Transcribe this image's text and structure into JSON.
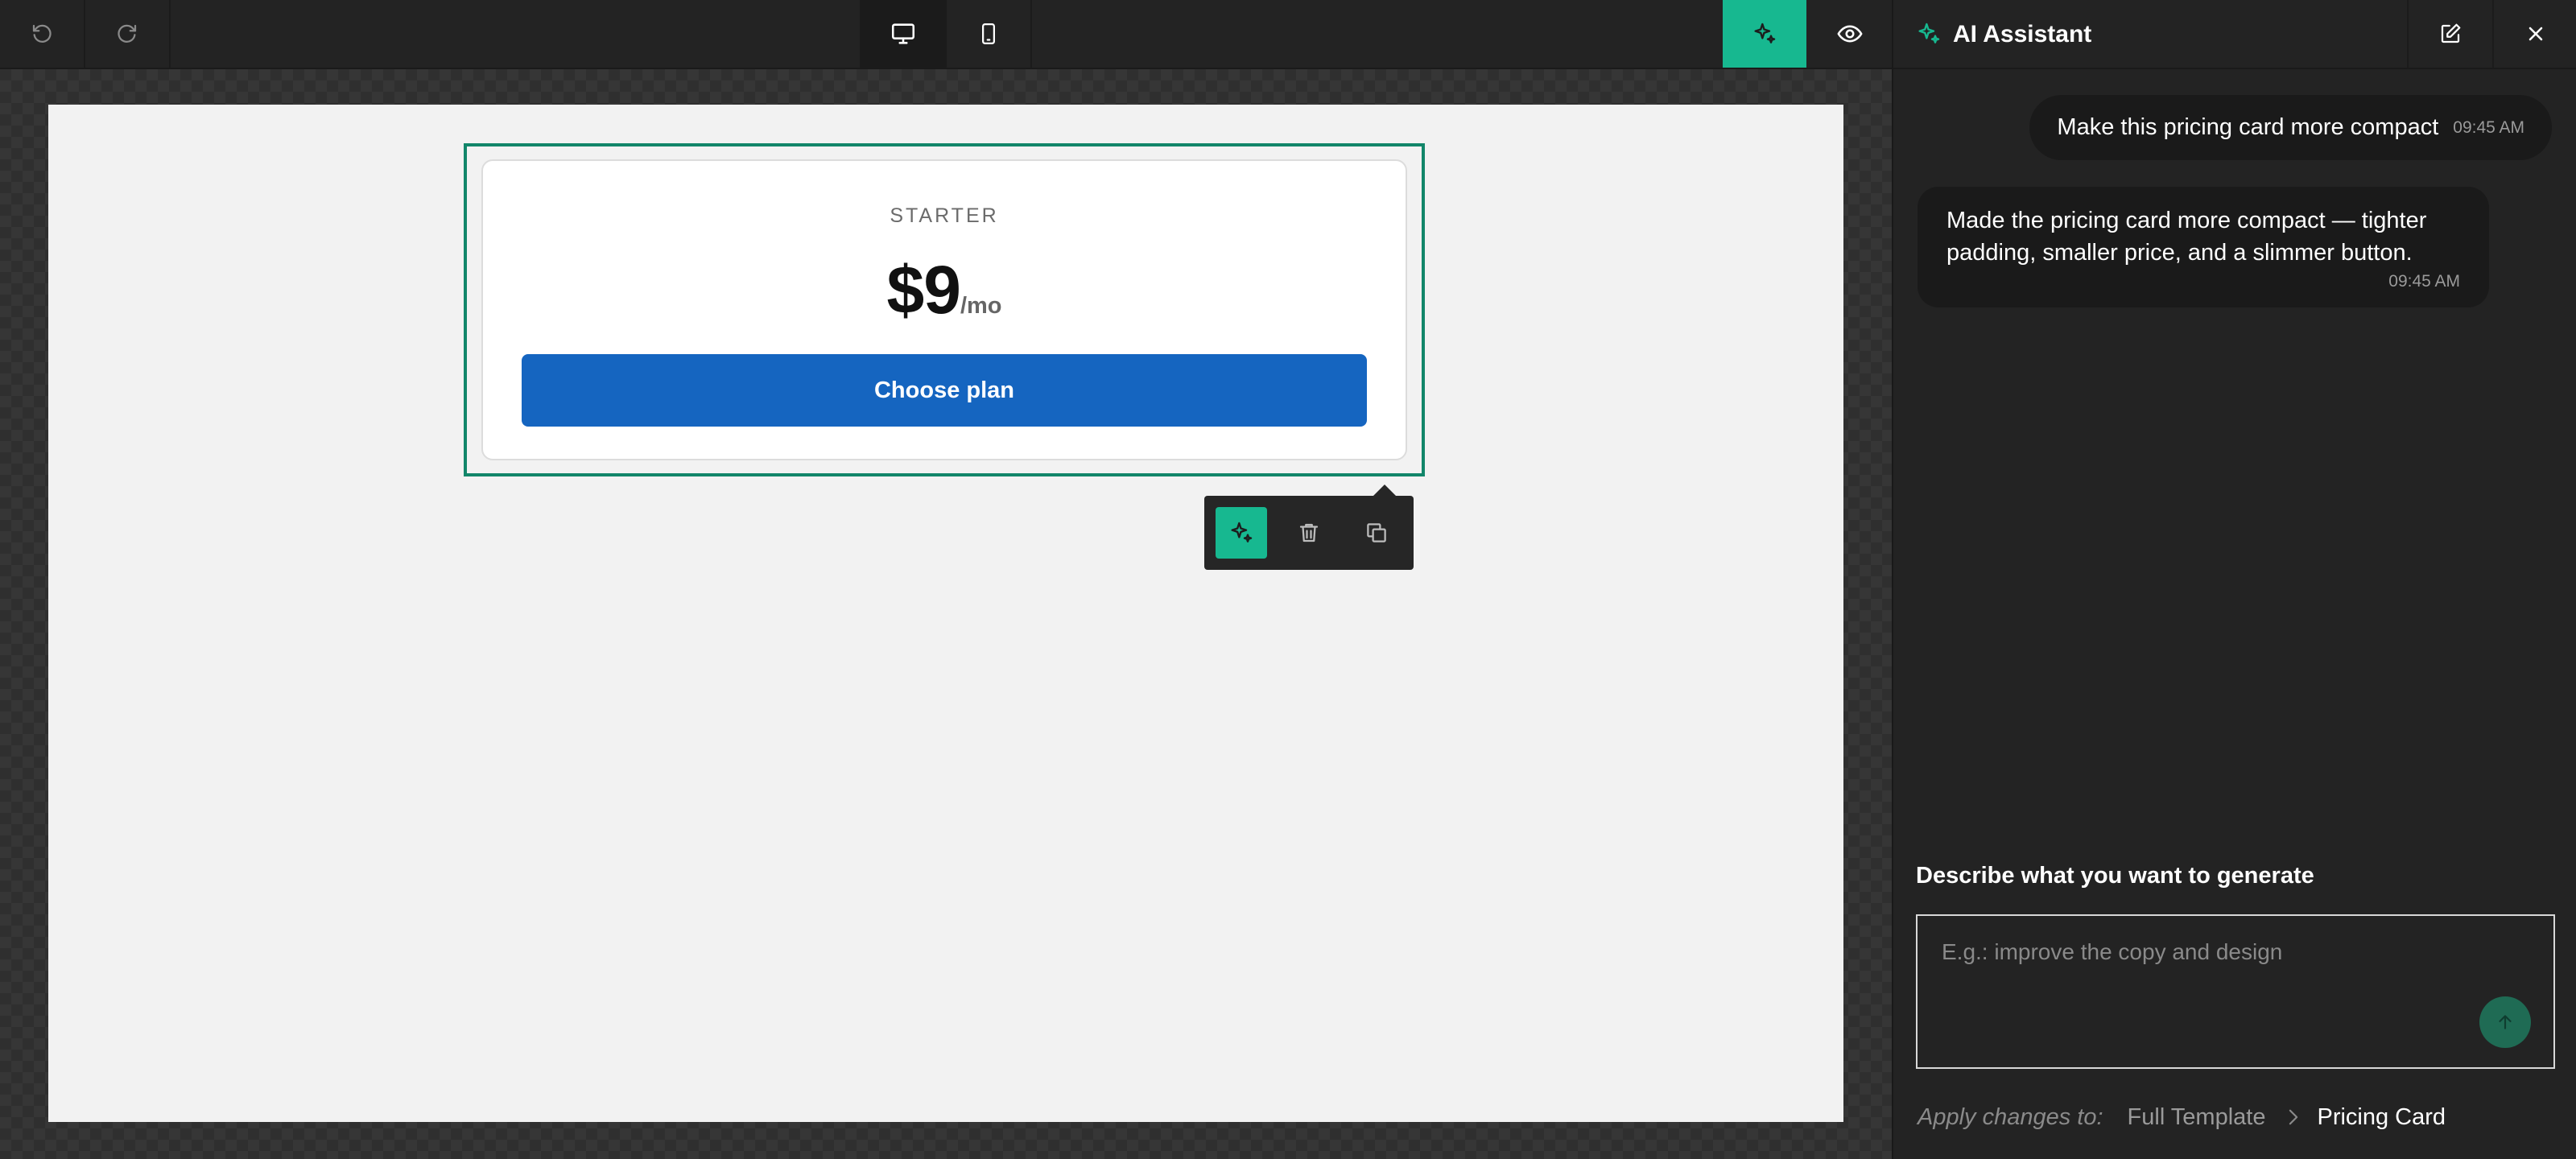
{
  "toolbar": {
    "undo_icon": "undo-icon",
    "redo_icon": "redo-icon",
    "desktop_icon": "desktop-icon",
    "mobile_icon": "mobile-icon",
    "ai_icon": "sparkle-icon",
    "preview_icon": "eye-icon",
    "accent_color": "#17b890"
  },
  "canvas": {
    "card": {
      "plan_name": "STARTER",
      "price": "$9",
      "price_unit": "/mo",
      "button_label": "Choose plan",
      "button_color": "#1565c0"
    },
    "selection_color": "#12866a",
    "element_toolbar": {
      "ai_icon": "sparkle-icon",
      "delete_icon": "trash-icon",
      "duplicate_icon": "duplicate-icon"
    }
  },
  "panel": {
    "title": "AI Assistant",
    "new_chat_icon": "edit-icon",
    "close_icon": "close-icon",
    "messages": [
      {
        "role": "user",
        "text": "Make this pricing card more compact",
        "time": "09:45 AM"
      },
      {
        "role": "assistant",
        "text": "Made the pricing card more compact — tighter padding, smaller price, and a slimmer button.",
        "time": "09:45 AM"
      }
    ],
    "generate_label": "Describe what you want to generate",
    "prompt_placeholder": "E.g.: improve the copy and design",
    "prompt_value": "",
    "send_icon": "arrow-up-icon",
    "apply": {
      "label": "Apply changes to:",
      "scope_full": "Full Template",
      "scope_current": "Pricing Card"
    }
  }
}
